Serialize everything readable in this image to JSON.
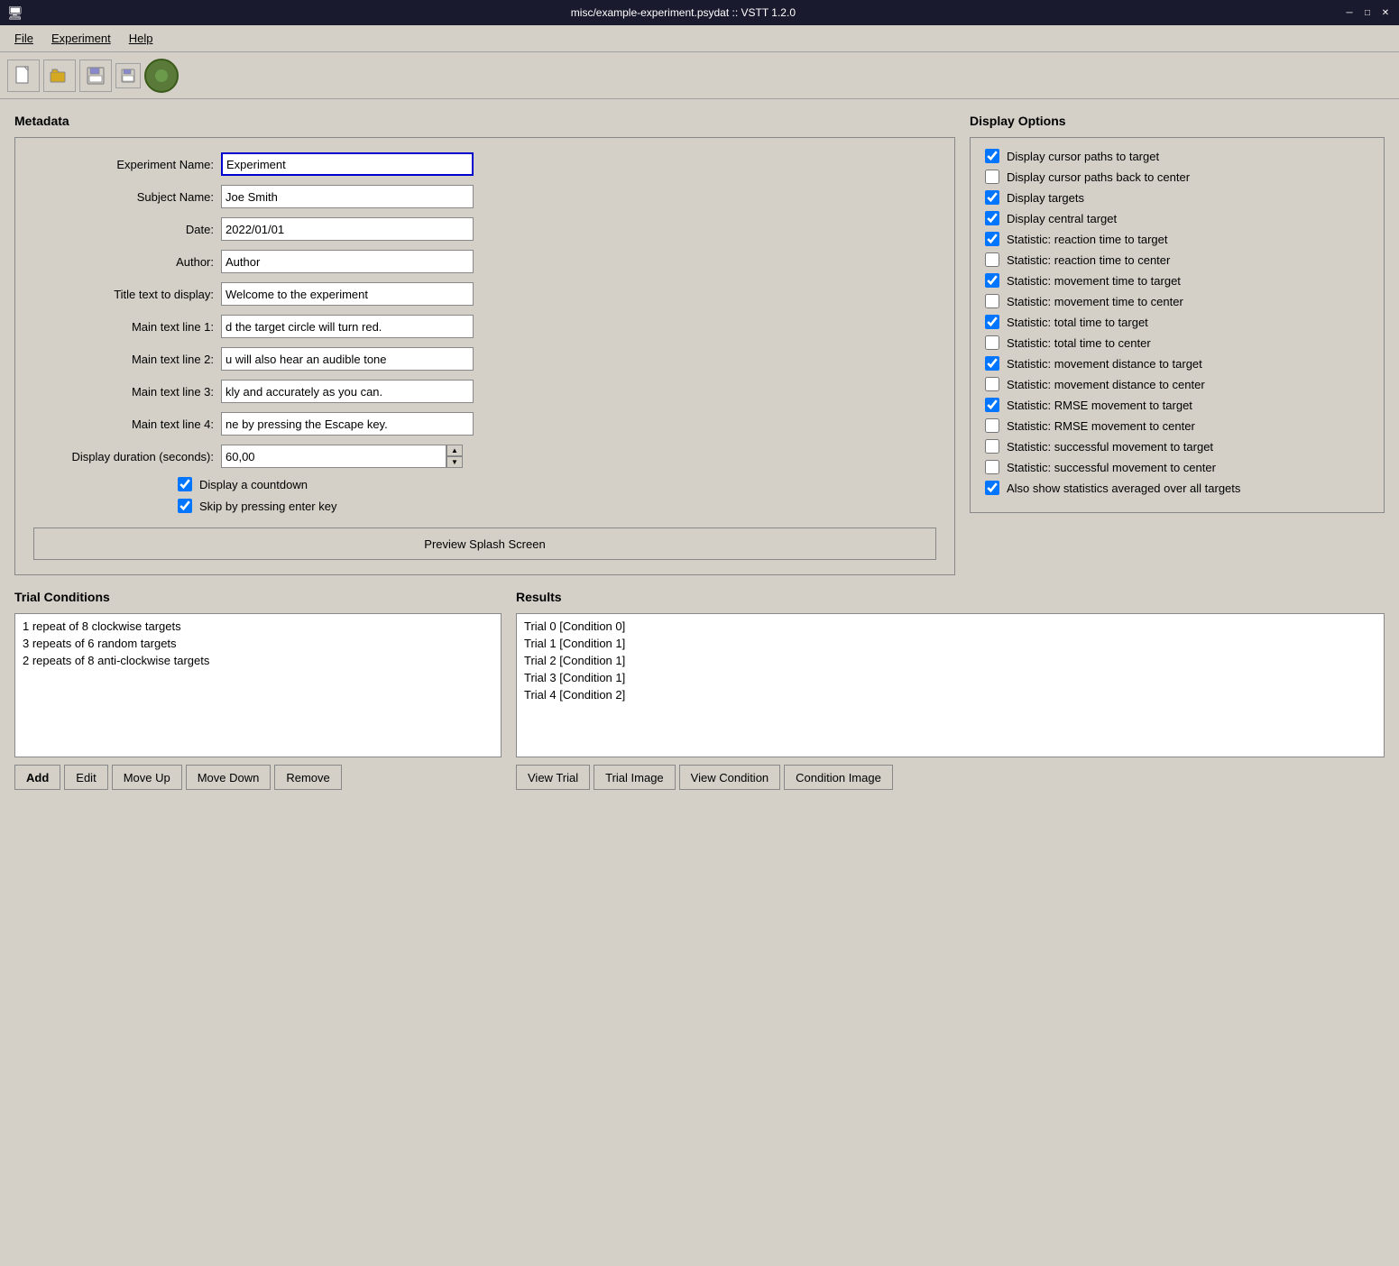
{
  "window": {
    "title": "misc/example-experiment.psydat :: VSTT 1.2.0",
    "controls": [
      "─",
      "□",
      "✕"
    ]
  },
  "menubar": {
    "items": [
      "File",
      "Experiment",
      "Help"
    ]
  },
  "toolbar": {
    "buttons": [
      {
        "name": "new-button",
        "icon": "🗋"
      },
      {
        "name": "open-button",
        "icon": "📂"
      },
      {
        "name": "save-button",
        "icon": "💾"
      },
      {
        "name": "save-small-button",
        "icon": "🖫"
      },
      {
        "name": "run-button",
        "icon": "●"
      }
    ]
  },
  "metadata": {
    "title": "Metadata",
    "fields": {
      "experiment_name_label": "Experiment Name:",
      "experiment_name_value": "Experiment",
      "subject_name_label": "Subject Name:",
      "subject_name_value": "Joe Smith",
      "date_label": "Date:",
      "date_value": "2022/01/01",
      "author_label": "Author:",
      "author_value": "Author",
      "title_text_label": "Title text to display:",
      "title_text_value": "Welcome to the experiment",
      "main_text_1_label": "Main text line 1:",
      "main_text_1_value": "d the target circle will turn red.",
      "main_text_2_label": "Main text line 2:",
      "main_text_2_value": "u will also hear an audible tone",
      "main_text_3_label": "Main text line 3:",
      "main_text_3_value": "kly and accurately as you can.",
      "main_text_4_label": "Main text line 4:",
      "main_text_4_value": "ne by pressing the Escape key.",
      "display_duration_label": "Display duration (seconds):",
      "display_duration_value": "60,00"
    },
    "checkboxes": {
      "display_countdown_label": "Display a countdown",
      "display_countdown_checked": true,
      "skip_enter_label": "Skip by pressing enter key",
      "skip_enter_checked": true
    },
    "preview_button": "Preview Splash Screen"
  },
  "display_options": {
    "title": "Display Options",
    "items": [
      {
        "label": "Display cursor paths to target",
        "checked": true
      },
      {
        "label": "Display cursor paths back to center",
        "checked": false
      },
      {
        "label": "Display targets",
        "checked": true
      },
      {
        "label": "Display central target",
        "checked": true
      },
      {
        "label": "Statistic: reaction time to target",
        "checked": true
      },
      {
        "label": "Statistic: reaction time to center",
        "checked": false
      },
      {
        "label": "Statistic: movement time to target",
        "checked": true
      },
      {
        "label": "Statistic: movement time to center",
        "checked": false
      },
      {
        "label": "Statistic: total time to target",
        "checked": true
      },
      {
        "label": "Statistic: total time to center",
        "checked": false
      },
      {
        "label": "Statistic: movement distance to target",
        "checked": true
      },
      {
        "label": "Statistic: movement distance to center",
        "checked": false
      },
      {
        "label": "Statistic: RMSE movement to target",
        "checked": true
      },
      {
        "label": "Statistic: RMSE movement to center",
        "checked": false
      },
      {
        "label": "Statistic: successful movement to target",
        "checked": false
      },
      {
        "label": "Statistic: successful movement to center",
        "checked": false
      },
      {
        "label": "Also show statistics averaged over all targets",
        "checked": true
      }
    ]
  },
  "trial_conditions": {
    "title": "Trial Conditions",
    "items": [
      "1 repeat of 8 clockwise targets",
      "3 repeats of 6 random targets",
      "2 repeats of 8 anti-clockwise targets"
    ],
    "buttons": [
      "Add",
      "Edit",
      "Move Up",
      "Move Down",
      "Remove"
    ]
  },
  "results": {
    "title": "Results",
    "items": [
      "Trial 0 [Condition 0]",
      "Trial 1 [Condition 1]",
      "Trial 2 [Condition 1]",
      "Trial 3 [Condition 1]",
      "Trial 4 [Condition 2]"
    ],
    "buttons": [
      "View Trial",
      "Trial Image",
      "View Condition",
      "Condition Image"
    ]
  }
}
